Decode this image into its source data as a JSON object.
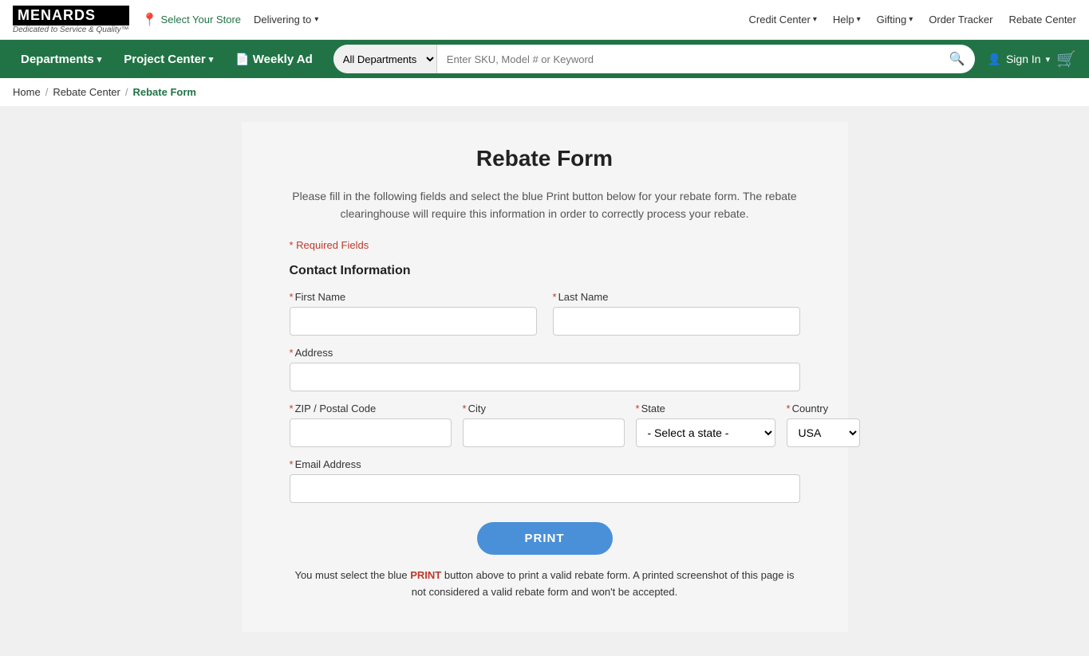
{
  "topbar": {
    "logo": "MENARDS",
    "tagline": "Dedicated to Service & Quality™",
    "store": {
      "label": "Select Your Store",
      "icon": "📍"
    },
    "delivering": {
      "label": "Delivering to",
      "chevron": "▾"
    },
    "nav_links": [
      {
        "label": "Credit Center",
        "has_chevron": true
      },
      {
        "label": "Help",
        "has_chevron": true
      },
      {
        "label": "Gifting",
        "has_chevron": true
      },
      {
        "label": "Order Tracker",
        "has_chevron": false
      },
      {
        "label": "Rebate Center",
        "has_chevron": false
      }
    ]
  },
  "navbar": {
    "items": [
      {
        "label": "Departments",
        "has_chevron": true,
        "has_icon": false
      },
      {
        "label": "Project Center",
        "has_chevron": true,
        "has_icon": false
      },
      {
        "label": "Weekly Ad",
        "has_chevron": false,
        "has_icon": true
      }
    ],
    "search": {
      "dept_placeholder": "All Departments",
      "input_placeholder": "Enter SKU, Model # or Keyword"
    },
    "sign_in": "Sign In",
    "sign_in_chevron": "▾"
  },
  "breadcrumb": {
    "items": [
      {
        "label": "Home",
        "link": true
      },
      {
        "label": "Rebate Center",
        "link": true
      },
      {
        "label": "Rebate Form",
        "link": false,
        "current": true
      }
    ]
  },
  "form": {
    "title": "Rebate Form",
    "description": "Please fill in the following fields and select the blue Print button below for your rebate form. The rebate clearinghouse will require this information in order to correctly process your rebate.",
    "required_note": "* Required Fields",
    "section_title": "Contact Information",
    "fields": {
      "first_name_label": "First Name",
      "last_name_label": "Last Name",
      "address_label": "Address",
      "zip_label": "ZIP / Postal Code",
      "city_label": "City",
      "state_label": "State",
      "state_placeholder": "- Select a state -",
      "country_label": "Country",
      "country_default": "USA",
      "email_label": "Email Address"
    },
    "print_button": "PRINT",
    "print_note": "You must select the blue PRINT button above to print a valid rebate form. A printed screenshot of this page is not considered a valid rebate form and won't be accepted."
  }
}
